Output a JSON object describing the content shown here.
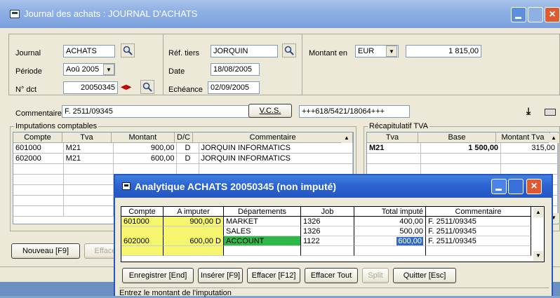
{
  "main_window": {
    "title": "Journal des achats : JOURNAL D'ACHATS",
    "journal_label": "Journal",
    "journal_value": "ACHATS",
    "periode_label": "Période",
    "periode_value": "Aoû 2005",
    "ndct_label": "N° dct",
    "ndct_value": "20050345",
    "ref_tiers_label": "Réf. tiers",
    "ref_tiers_value": "JORQUIN",
    "date_label": "Date",
    "date_value": "18/08/2005",
    "echeance_label": "Echéance",
    "echeance_value": "02/09/2005",
    "montant_label": "Montant en",
    "currency_value": "EUR",
    "amount_value": "1 815,00",
    "commentaire_label": "Commentaire",
    "commentaire_value": "F. 2511/09345",
    "vcs_label": "V.C.S.",
    "vcs_value": "+++618/5421/18064+++",
    "imputations_title": "Imputations comptables",
    "imputations_headers": [
      "Compte",
      "Tva",
      "Montant",
      "D/C",
      "Commentaire"
    ],
    "imputations_rows": [
      [
        "601000",
        "M21",
        "900,00",
        "D",
        "JORQUIN INFORMATICS"
      ],
      [
        "602000",
        "M21",
        "600,00",
        "D",
        "JORQUIN INFORMATICS"
      ]
    ],
    "recap_title": "Récapitulatif TVA",
    "recap_headers": [
      "Tva",
      "Base",
      "Montant Tva"
    ],
    "recap_rows": [
      [
        "M21",
        "1 500,00",
        "315,00"
      ]
    ],
    "nouveau_button": "Nouveau [F9]",
    "effacer_button": "Efface"
  },
  "dialog": {
    "title": "Analytique ACHATS 20050345 (non imputé)",
    "headers": [
      "Compte",
      "A imputer",
      "Départements",
      "Job",
      "Total imputé",
      "Commentaire"
    ],
    "rows": [
      [
        "601000",
        "900,00 D",
        "MARKET",
        "1326",
        "400,00",
        "F. 2511/09345"
      ],
      [
        "",
        "",
        "SALES",
        "1326",
        "500,00",
        "F. 2511/09345"
      ],
      [
        "602000",
        "600,00 D",
        "ACCOUNT",
        "1122",
        "600,00",
        "F. 2511/09345"
      ]
    ],
    "buttons": [
      "Enregistrer [End]",
      "Insérer [F9]",
      "Effacer [F12]",
      "Effacer Tout",
      "Split",
      "Quitter [Esc]"
    ],
    "status_text": "Entrez le montant de l'imputation"
  },
  "colors": {
    "highlight_yellow": "#f5f56e",
    "highlight_green": "#2fb84a",
    "selection_blue": "#316ac5",
    "close_red": "#e05a2f"
  }
}
